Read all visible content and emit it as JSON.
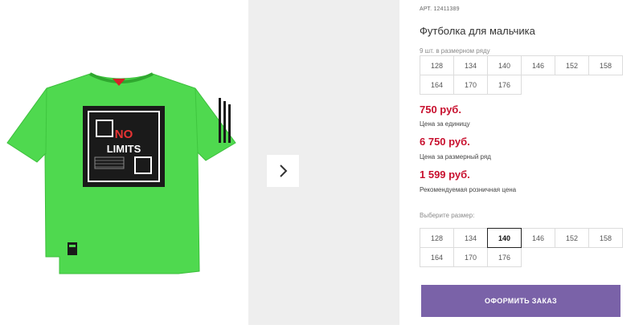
{
  "product": {
    "art_label": "АРТ.",
    "art_number": "12411389",
    "title": "Футболка для мальчика",
    "print_text": "NO LIMITS"
  },
  "size_row": {
    "caption": "9 шт. в размерном ряду",
    "sizes": [
      "128",
      "134",
      "140",
      "146",
      "152",
      "158",
      "164",
      "170",
      "176"
    ]
  },
  "prices": {
    "unit_price": "750 руб.",
    "unit_label": "Цена за единицу",
    "row_price": "6 750 руб.",
    "row_label": "Цена за размерный ряд",
    "retail_price": "1 599 руб.",
    "retail_label": "Рекомендуемая розничная цена"
  },
  "size_select": {
    "caption": "Выберите размер:",
    "sizes": [
      "128",
      "134",
      "140",
      "146",
      "152",
      "158",
      "164",
      "170",
      "176"
    ],
    "selected": "140"
  },
  "order_button": "ОФОРМИТЬ ЗАКАЗ",
  "colors": {
    "price": "#c8102e",
    "button": "#7a62a8",
    "shirt": "#4fd94f",
    "thumb_bg": "#eeeeee"
  },
  "icons": {
    "next": "chevron-right-icon"
  }
}
